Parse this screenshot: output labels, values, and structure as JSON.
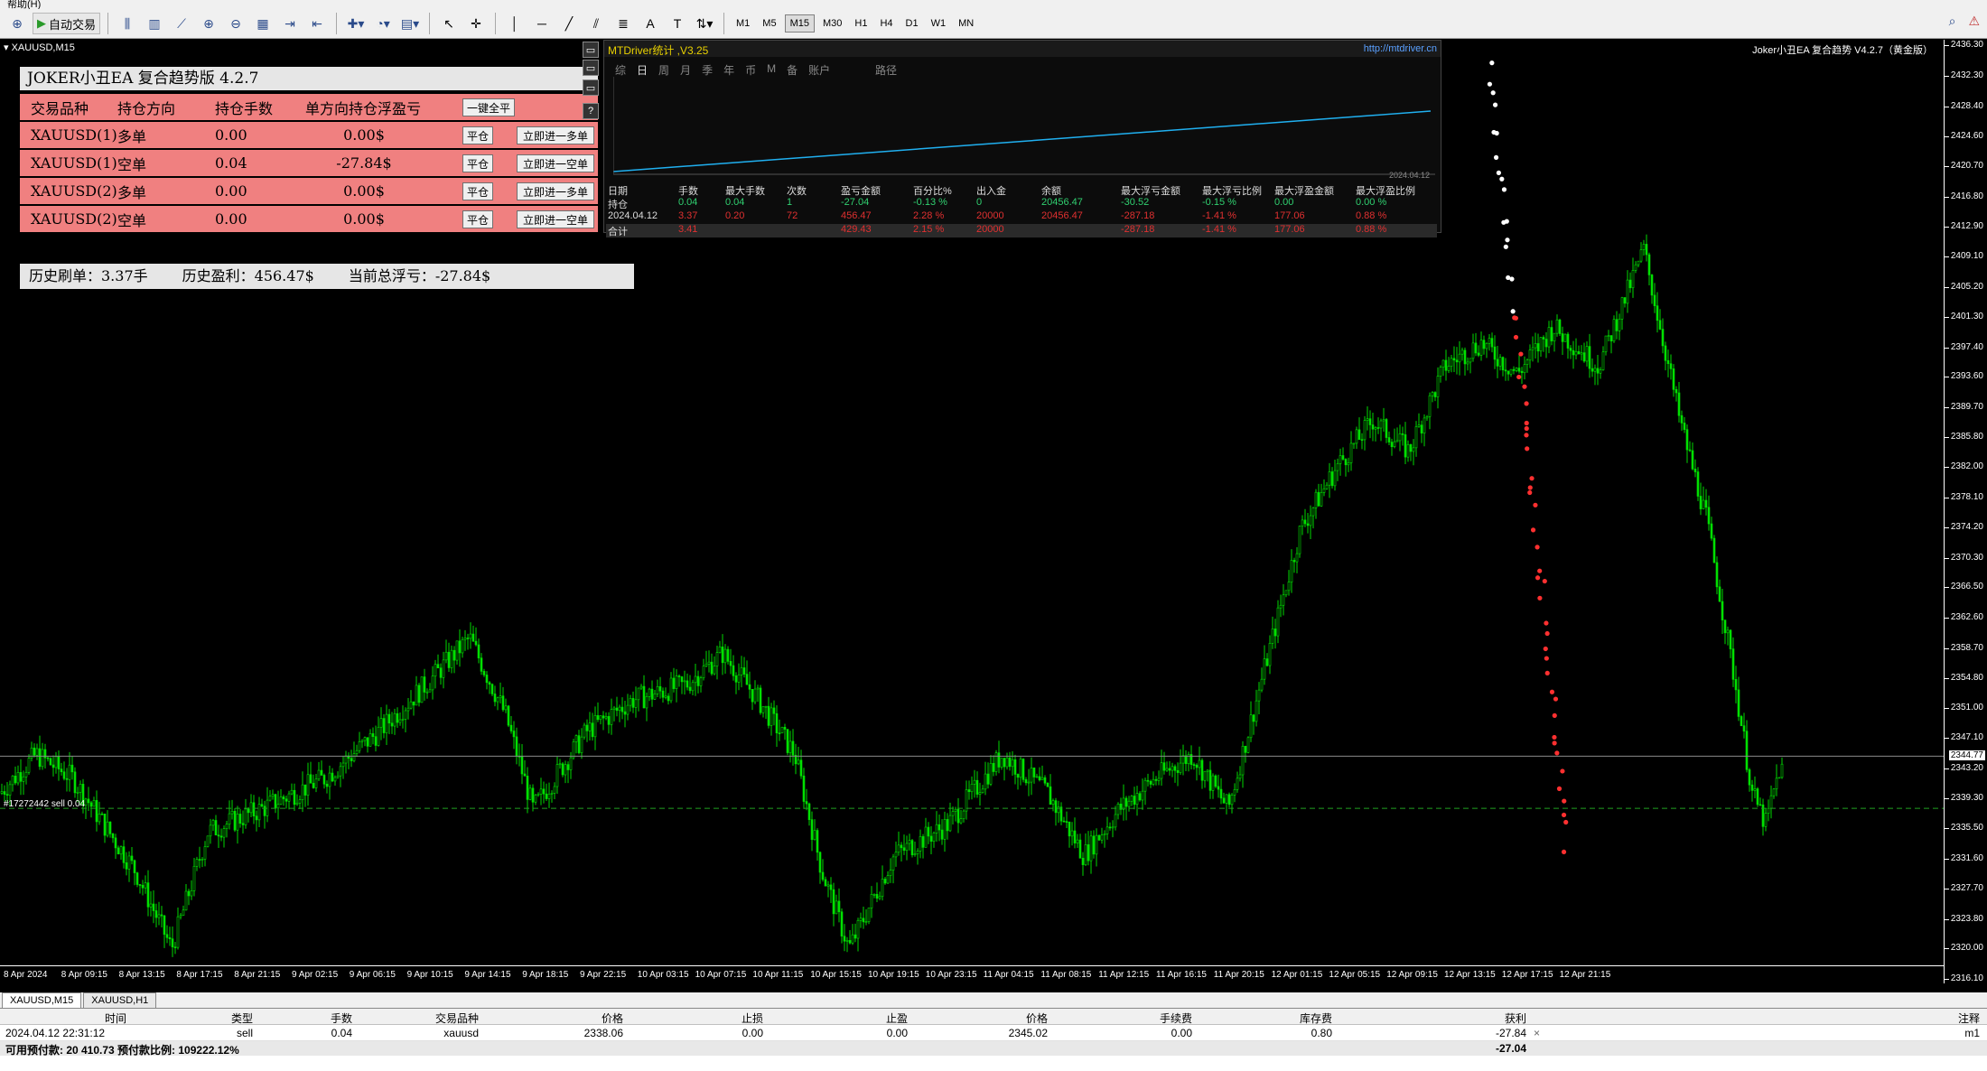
{
  "menu": {
    "label": "帮助(H)"
  },
  "toolbar": {
    "auto_trade": "自动交易",
    "timeframes": [
      "M1",
      "M5",
      "M15",
      "M30",
      "H1",
      "H4",
      "D1",
      "W1",
      "MN"
    ],
    "active_timeframe": "M15"
  },
  "chart": {
    "symbol_title": "XAUUSD,M15",
    "ea_title_right": "Joker小丑EA 复合趋势 V4.2.7（黄金版）",
    "current_price": "2344.77",
    "order_label": "#17272442 sell 0.04",
    "price_labels": [
      "2436.30",
      "2432.30",
      "2428.40",
      "2424.60",
      "2420.70",
      "2416.80",
      "2412.90",
      "2409.10",
      "2405.20",
      "2401.30",
      "2397.40",
      "2393.60",
      "2389.70",
      "2385.80",
      "2382.00",
      "2378.10",
      "2374.20",
      "2370.30",
      "2366.50",
      "2362.60",
      "2358.70",
      "2354.80",
      "2351.00",
      "2347.10",
      "2343.20",
      "2339.30",
      "2335.50",
      "2331.60",
      "2327.70",
      "2323.80",
      "2320.00",
      "2316.10"
    ],
    "time_labels": [
      "8 Apr 2024",
      "8 Apr 09:15",
      "8 Apr 13:15",
      "8 Apr 17:15",
      "8 Apr 21:15",
      "9 Apr 02:15",
      "9 Apr 06:15",
      "9 Apr 10:15",
      "9 Apr 14:15",
      "9 Apr 18:15",
      "9 Apr 22:15",
      "10 Apr 03:15",
      "10 Apr 07:15",
      "10 Apr 11:15",
      "10 Apr 15:15",
      "10 Apr 19:15",
      "10 Apr 23:15",
      "11 Apr 04:15",
      "11 Apr 08:15",
      "11 Apr 12:15",
      "11 Apr 16:15",
      "11 Apr 20:15",
      "12 Apr 01:15",
      "12 Apr 05:15",
      "12 Apr 09:15",
      "12 Apr 13:15",
      "12 Apr 17:15",
      "12 Apr 21:15"
    ],
    "colors": {
      "bull": "#00e000",
      "bear": "#00b000",
      "grid": "#ffffff"
    }
  },
  "ea": {
    "title": "JOKER小丑EA 复合趋势版 4.2.7",
    "headers": [
      "交易品种",
      "持仓方向",
      "持仓手数",
      "单方向持仓浮盈亏"
    ],
    "close_all": "一键全平",
    "side_help": "?",
    "rows": [
      {
        "symbol": "XAUUSD(1)",
        "dir": "多单",
        "lots": "0.00",
        "pl": "0.00$",
        "close": "平仓",
        "open": "立即进一多单"
      },
      {
        "symbol": "XAUUSD(1)",
        "dir": "空单",
        "lots": "0.04",
        "pl": "-27.84$",
        "close": "平仓",
        "open": "立即进一空单"
      },
      {
        "symbol": "XAUUSD(2)",
        "dir": "多单",
        "lots": "0.00",
        "pl": "0.00$",
        "close": "平仓",
        "open": "立即进一多单"
      },
      {
        "symbol": "XAUUSD(2)",
        "dir": "空单",
        "lots": "0.00",
        "pl": "0.00$",
        "close": "平仓",
        "open": "立即进一空单"
      }
    ],
    "history": {
      "volume": "历史刷单：3.37手",
      "profit": "历史盈利：456.47$",
      "float": "当前总浮亏：-27.84$"
    }
  },
  "mtd": {
    "name": "MTDriver统计 ,V3.25",
    "url": "http://mtdriver.cn",
    "tabs": [
      "综",
      "日",
      "周",
      "月",
      "季",
      "年",
      "币",
      "M",
      "备",
      "账户"
    ],
    "active_tab": "日",
    "path": "路径",
    "graph_date": "2024.04.12",
    "columns": [
      "日期",
      "手数",
      "最大手数",
      "次数",
      "盈亏金额",
      "百分比%",
      "出入金",
      "余额",
      "最大浮亏金额",
      "最大浮亏比例",
      "最大浮盈金额",
      "最大浮盈比例"
    ],
    "rows": [
      {
        "cells": [
          "持仓",
          "0.04",
          "0.04",
          "1",
          "-27.04",
          "-0.13 %",
          "0",
          "20456.47",
          "-30.52",
          "-0.15 %",
          "0.00",
          "0.00 %"
        ],
        "color": "#30d070"
      },
      {
        "cells": [
          "2024.04.12",
          "3.37",
          "0.20",
          "72",
          "456.47",
          "2.28 %",
          "20000",
          "20456.47",
          "-287.18",
          "-1.41 %",
          "177.06",
          "0.88 %"
        ],
        "color": "#e03030"
      },
      {
        "cells": [
          "合计",
          "3.41",
          "",
          "",
          "429.43",
          "2.15 %",
          "20000",
          "",
          "-287.18",
          "-1.41 %",
          "177.06",
          "0.88 %"
        ],
        "color": "#e03030"
      }
    ]
  },
  "terminal": {
    "tabs": [
      "XAUUSD,M15",
      "XAUUSD,H1"
    ],
    "headers": [
      "时间",
      "类型",
      "手数",
      "交易品种",
      "价格",
      "止损",
      "止盈",
      "价格",
      "手续费",
      "库存费",
      "获利",
      "注释"
    ],
    "row": [
      "2024.04.12 22:31:12",
      "sell",
      "0.04",
      "xauusd",
      "2338.06",
      "0.00",
      "0.00",
      "2345.02",
      "0.00",
      "0.80",
      "-27.84",
      "m1"
    ],
    "close_x": "×",
    "footer_left": "可用预付款: 20 410.73  预付款比例: 109222.12%",
    "footer_profit": "-27.04"
  }
}
